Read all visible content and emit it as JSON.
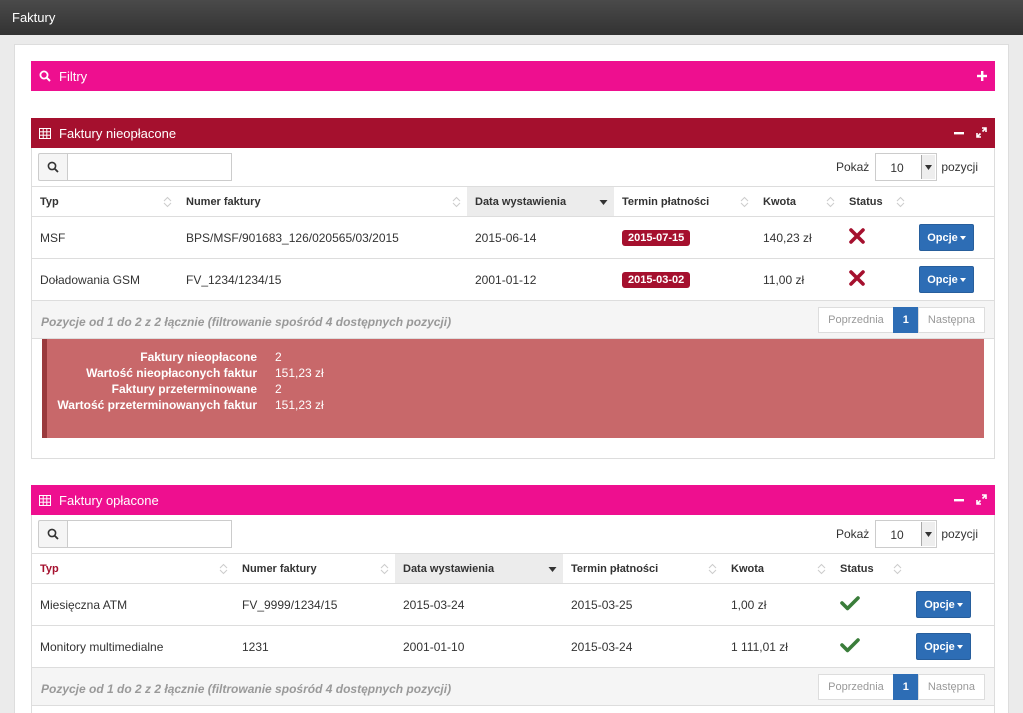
{
  "topbar": {
    "title": "Faktury"
  },
  "filters": {
    "title": "Filtry"
  },
  "unpaid": {
    "title": "Faktury nieopłacone",
    "show_label": "Pokaż",
    "page_size": "10",
    "entries_label": "pozycji",
    "columns": [
      "Typ",
      "Numer faktury",
      "Data wystawienia",
      "Termin płatności",
      "Kwota",
      "Status"
    ],
    "rows": [
      {
        "type": "MSF",
        "number": "BPS/MSF/901683_126/020565/03/2015",
        "issued": "2015-06-14",
        "due": "2015-07-15",
        "amount": "140,23 zł",
        "options": "Opcje"
      },
      {
        "type": "Doładowania GSM",
        "number": "FV_1234/1234/15",
        "issued": "2001-01-12",
        "due": "2015-03-02",
        "amount": "11,00 zł",
        "options": "Opcje"
      }
    ],
    "info": "Pozycje od 1 do 2 z 2 łącznie (filtrowanie spośród 4 dostępnych pozycji)",
    "pagination": {
      "prev": "Poprzednia",
      "page": "1",
      "next": "Następna"
    },
    "summary": [
      {
        "label": "Faktury nieopłacone",
        "value": "2"
      },
      {
        "label": "Wartość nieopłaconych faktur",
        "value": "151,23 zł"
      },
      {
        "label": "Faktury przeterminowane",
        "value": "2"
      },
      {
        "label": "Wartość przeterminowanych faktur",
        "value": "151,23 zł"
      }
    ]
  },
  "paid": {
    "title": "Faktury opłacone",
    "show_label": "Pokaż",
    "page_size": "10",
    "entries_label": "pozycji",
    "columns": [
      "Typ",
      "Numer faktury",
      "Data wystawienia",
      "Termin płatności",
      "Kwota",
      "Status"
    ],
    "rows": [
      {
        "type": "Miesięczna ATM",
        "number": "FV_9999/1234/15",
        "issued": "2015-03-24",
        "due": "2015-03-25",
        "amount": "1,00 zł",
        "options": "Opcje"
      },
      {
        "type": "Monitory multimedialne",
        "number": "1231",
        "issued": "2001-01-10",
        "due": "2015-03-24",
        "amount": "1 111,01 zł",
        "options": "Opcje"
      }
    ],
    "info": "Pozycje od 1 do 2 z 2 łącznie (filtrowanie spośród 4 dostępnych pozycji)",
    "pagination": {
      "prev": "Poprzednia",
      "page": "1",
      "next": "Następna"
    }
  },
  "colors": {
    "pink": "#ee0f8f",
    "crimson": "#a5102e",
    "button_blue": "#2d6db5",
    "ok_green": "#3a7d3a"
  },
  "icons": {
    "search": "search-icon",
    "table": "table-icon",
    "plus": "plus-icon",
    "minus": "minimize-icon",
    "expand": "expand-icon",
    "failed": "x-mark-icon",
    "paid": "checkmark-icon"
  }
}
